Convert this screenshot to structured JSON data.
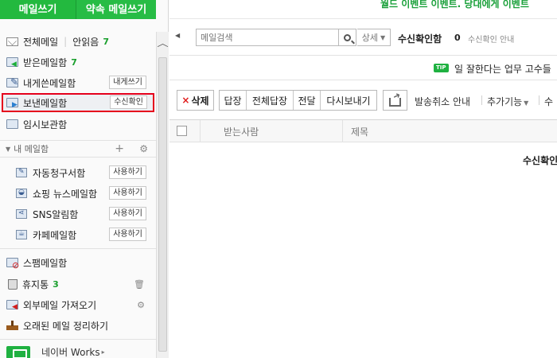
{
  "compose": {
    "write": "메일쓰기",
    "reserve": "약속 메일쓰기"
  },
  "sidebar": {
    "all_mail": "전체메일",
    "unread": "안읽음",
    "unread_count": "7",
    "inbox": {
      "label": "받은메일함",
      "count": "7"
    },
    "self": {
      "label": "내게쓴메일함",
      "button": "내게쓰기"
    },
    "sent": {
      "label": "보낸메일함",
      "button": "수신확인"
    },
    "temp": {
      "label": "임시보관함"
    },
    "my_boxes_header": "내 메일함",
    "my_boxes": [
      {
        "label": "자동청구서함",
        "button": "사용하기"
      },
      {
        "label": "쇼핑 뉴스메일함",
        "button": "사용하기"
      },
      {
        "label": "SNS알림함",
        "button": "사용하기"
      },
      {
        "label": "카페메일함",
        "button": "사용하기"
      }
    ],
    "spam": "스팸메일함",
    "trash": {
      "label": "휴지통",
      "count": "3"
    },
    "external": "외부메일 가져오기",
    "cleanup": "오래된 메일 정리하기",
    "works": "네이버 Works"
  },
  "main": {
    "banner": "월드 이벤트 이벤트. 당대에게 이벤트",
    "search": {
      "placeholder": "메일검색",
      "detail": "상세"
    },
    "mailbox_name": "수신확인함",
    "mailbox_count": "0",
    "mailbox_guide": "수신확인 안내",
    "tip_badge": "TIP",
    "tip_text": "일 잘한다는 업무 고수들",
    "toolbar": {
      "delete": "삭제",
      "reply": "답장",
      "reply_all": "전체답장",
      "forward": "전달",
      "resend": "다시보내기",
      "cancel_send_guide": "발송취소 안내",
      "more": "추가기능",
      "extra": "수"
    },
    "table": {
      "col_recipient": "받는사람",
      "col_subject": "제목"
    },
    "empty": "수신확인"
  }
}
